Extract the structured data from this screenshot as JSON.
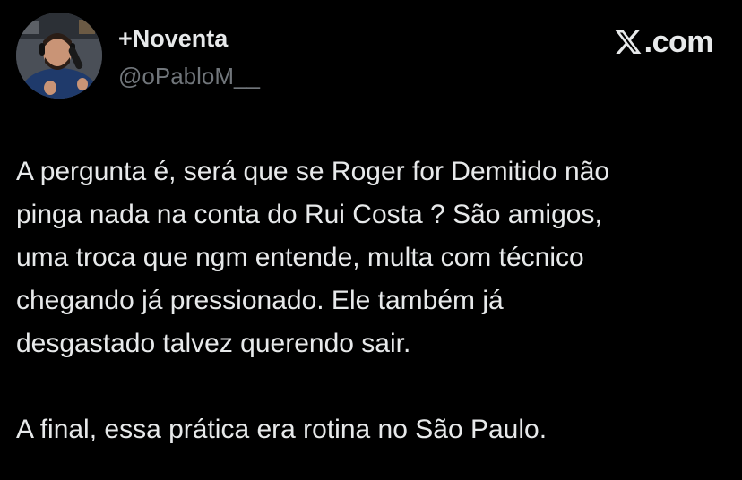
{
  "author": {
    "display_name": "+Noventa",
    "handle": "@oPabloM__",
    "avatar_icon": "person-with-microphone-avatar"
  },
  "brand": {
    "logo_icon": "x-logo-icon",
    "text": ".com"
  },
  "tweet": {
    "paragraphs": [
      "A pergunta é, será que se Roger for Demitido não\npinga nada na conta do Rui Costa ? São amigos,\numa troca que ngm entende, multa com técnico\nchegando já pressionado. Ele também já\ndesgastado talvez querendo sair.",
      "A final, essa prática era rotina no São Paulo."
    ]
  },
  "colors": {
    "background": "#000000",
    "primary_text": "#e7e9ea",
    "secondary_text": "#71767b"
  }
}
